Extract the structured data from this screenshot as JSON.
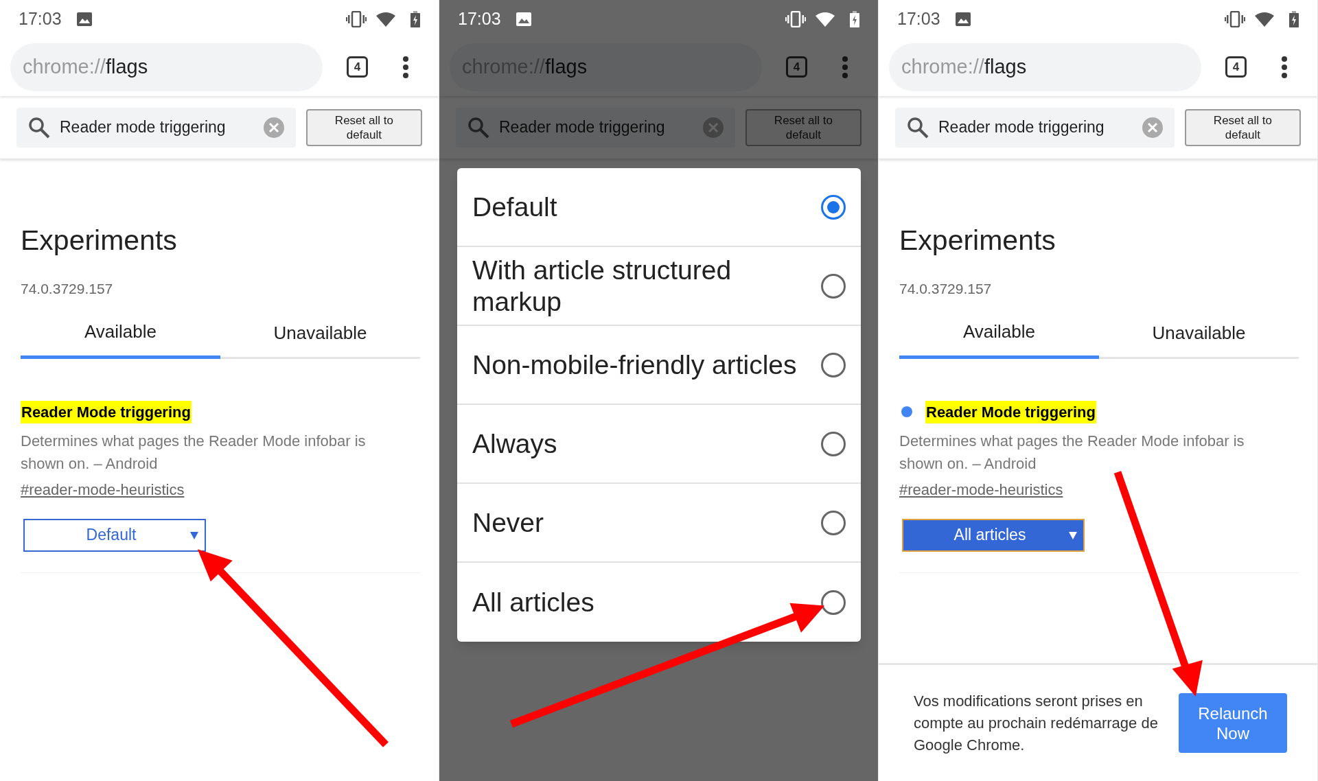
{
  "panels": [
    {
      "dimmed": false,
      "status_bar": {
        "time": "17:03"
      },
      "address_bar": {
        "scheme": "chrome://",
        "path": "flags"
      },
      "tab_count": "4",
      "search": {
        "value": "Reader mode triggering"
      },
      "reset_button": "Reset all to default",
      "page": {
        "title": "Experiments",
        "version": "74.0.3729.157",
        "tabs": [
          {
            "label": "Available",
            "selected": true
          },
          {
            "label": "Unavailable",
            "selected": false
          }
        ],
        "flag": {
          "title": "Reader Mode triggering",
          "modified": false,
          "description": "Determines what pages the Reader Mode infobar is shown on. – Android",
          "link": "#reader-mode-heuristics",
          "select": {
            "value": "Default"
          }
        }
      }
    },
    {
      "dimmed": true,
      "status_bar": {
        "time": "17:03"
      },
      "address_bar": {
        "scheme": "chrome://",
        "path": "flags"
      },
      "tab_count": "4",
      "search": {
        "value": "Reader mode triggering"
      },
      "reset_button": "Reset all to default",
      "dialog": {
        "options": [
          {
            "label": "Default",
            "selected": true
          },
          {
            "label": "With article structured markup",
            "selected": false
          },
          {
            "label": "Non-mobile-friendly articles",
            "selected": false
          },
          {
            "label": "Always",
            "selected": false
          },
          {
            "label": "Never",
            "selected": false
          },
          {
            "label": "All articles",
            "selected": false
          }
        ]
      }
    },
    {
      "dimmed": false,
      "status_bar": {
        "time": "17:03"
      },
      "address_bar": {
        "scheme": "chrome://",
        "path": "flags"
      },
      "tab_count": "4",
      "search": {
        "value": "Reader mode triggering"
      },
      "reset_button": "Reset all to default",
      "page": {
        "title": "Experiments",
        "version": "74.0.3729.157",
        "tabs": [
          {
            "label": "Available",
            "selected": true
          },
          {
            "label": "Unavailable",
            "selected": false
          }
        ],
        "flag": {
          "title": "Reader Mode triggering",
          "modified": true,
          "description": "Determines what pages the Reader Mode infobar is shown on. – Android",
          "link": "#reader-mode-heuristics",
          "select": {
            "value": "All articles"
          }
        }
      },
      "relaunch_bar": {
        "message": "Vos modifications seront prises en compte au prochain redémarrage de Google Chrome.",
        "button": "Relaunch Now"
      }
    }
  ]
}
